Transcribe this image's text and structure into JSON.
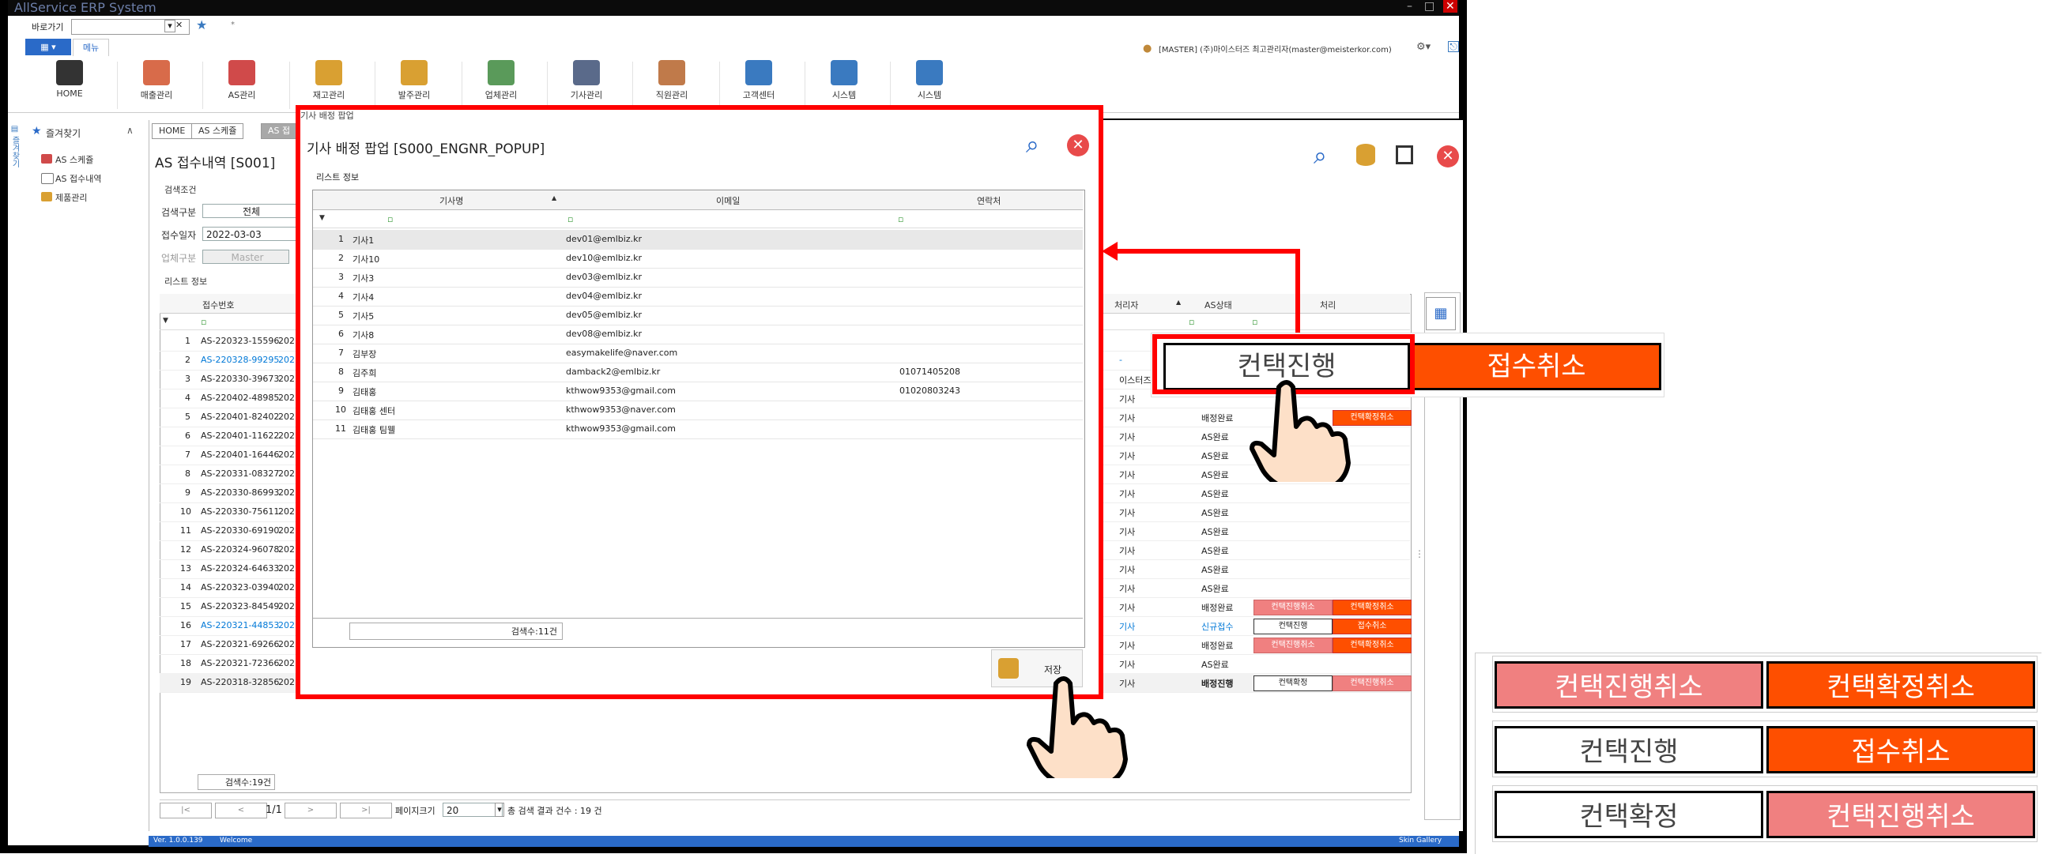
{
  "app": {
    "title": "AllService ERP System",
    "window_controls": [
      "–",
      "□",
      "✕"
    ],
    "quick_label": "바로가기",
    "user_info": "[MASTER] (주)마이스터즈 최고관리자(master@meisterkor.com)",
    "menu_tab": "메뉴",
    "version": "Ver. 1.0.0.139",
    "status_welcome": "Welcome",
    "skin_gallery": "Skin Gallery"
  },
  "ribbon": [
    {
      "label": "HOME",
      "icon": "home-icon",
      "color": "#333333"
    },
    {
      "label": "매출관리",
      "icon": "sales-icon",
      "color": "#d86b4a"
    },
    {
      "label": "AS관리",
      "icon": "as-icon",
      "color": "#d04a4a"
    },
    {
      "label": "재고관리",
      "icon": "inventory-icon",
      "color": "#d9a032"
    },
    {
      "label": "발주관리",
      "icon": "order-icon",
      "color": "#d9a032"
    },
    {
      "label": "업체관리",
      "icon": "company-icon",
      "color": "#5a9a5a"
    },
    {
      "label": "기사관리",
      "icon": "engineer-card-icon",
      "color": "#5a6a8a"
    },
    {
      "label": "직원관리",
      "icon": "staff-icon",
      "color": "#c07a4a"
    },
    {
      "label": "고객센터",
      "icon": "customer-icon",
      "color": "#3a7ac0"
    },
    {
      "label": "시스템",
      "icon": "system-doc-icon",
      "color": "#3a7ac0"
    },
    {
      "label": "시스템",
      "icon": "gears-icon",
      "color": "#3a7ac0"
    }
  ],
  "sidebar": {
    "title": "즐겨찾기",
    "items": [
      {
        "label": "AS 스케쥴"
      },
      {
        "label": "AS 접수내역"
      },
      {
        "label": "제품관리"
      }
    ]
  },
  "tabs": [
    "HOME",
    "AS 스케쥴",
    "AS 접"
  ],
  "page": {
    "title": "AS 접수내역 [S001]",
    "search_group": "검색조건",
    "search_type_label": "검색구분",
    "search_type_value": "전체",
    "receipt_date_label": "접수일자",
    "receipt_date_value": "2022-03-03",
    "company_type_label": "업체구분",
    "company_type_value": "Master",
    "list_group": "리스트 정보",
    "col_receipt_no": "접수번호",
    "col_handler": "처리자",
    "col_as_status": "AS상태",
    "col_process": "처리",
    "count_text": "검색수:19건",
    "pager": {
      "first": "|<",
      "prev": "<",
      "page": "1/1",
      "next": ">",
      "last": ">|",
      "size_label": "페이지크기",
      "size_value": "20",
      "total": "총 검색 결과 건수 : 19 건"
    }
  },
  "bg_rows": [
    {
      "no": "1",
      "receipt": "AS-220323-15596",
      "date": "202",
      "handler": "",
      "status": "",
      "btn1": "",
      "btn2": ""
    },
    {
      "no": "2",
      "receipt": "AS-220328-99295",
      "date": "202",
      "handler": "-",
      "status": "",
      "btn1": "",
      "btn2": "",
      "blue": true
    },
    {
      "no": "3",
      "receipt": "AS-220330-39673",
      "date": "202",
      "handler": "이스터즈 최고",
      "status": "",
      "btn1": "",
      "btn2": ""
    },
    {
      "no": "4",
      "receipt": "AS-220402-48985",
      "date": "202",
      "handler": "기사",
      "status": "",
      "btn1": "",
      "btn2": ""
    },
    {
      "no": "5",
      "receipt": "AS-220401-82402",
      "date": "202",
      "handler": "기사",
      "status": "배정완료",
      "btn1": "",
      "btn2": "컨택확정취소"
    },
    {
      "no": "6",
      "receipt": "AS-220401-11622",
      "date": "202",
      "handler": "기사",
      "status": "AS완료",
      "btn1": "",
      "btn2": ""
    },
    {
      "no": "7",
      "receipt": "AS-220401-16446",
      "date": "202",
      "handler": "기사",
      "status": "AS완료",
      "btn1": "",
      "btn2": ""
    },
    {
      "no": "8",
      "receipt": "AS-220331-08327",
      "date": "202",
      "handler": "기사",
      "status": "AS완료",
      "btn1": "",
      "btn2": ""
    },
    {
      "no": "9",
      "receipt": "AS-220330-86993",
      "date": "202",
      "handler": "기사",
      "status": "AS완료",
      "btn1": "",
      "btn2": ""
    },
    {
      "no": "10",
      "receipt": "AS-220330-75611",
      "date": "202",
      "handler": "기사",
      "status": "AS완료",
      "btn1": "",
      "btn2": ""
    },
    {
      "no": "11",
      "receipt": "AS-220330-69190",
      "date": "202",
      "handler": "기사",
      "status": "AS완료",
      "btn1": "",
      "btn2": ""
    },
    {
      "no": "12",
      "receipt": "AS-220324-96078",
      "date": "202",
      "handler": "기사",
      "status": "AS완료",
      "btn1": "",
      "btn2": ""
    },
    {
      "no": "13",
      "receipt": "AS-220324-64633",
      "date": "202",
      "handler": "기사",
      "status": "AS완료",
      "btn1": "",
      "btn2": ""
    },
    {
      "no": "14",
      "receipt": "AS-220323-03940",
      "date": "202",
      "handler": "기사",
      "status": "AS완료",
      "btn1": "",
      "btn2": ""
    },
    {
      "no": "15",
      "receipt": "AS-220323-84549",
      "date": "202",
      "handler": "기사",
      "status": "배정완료",
      "btn1": "컨택진행취소",
      "btn2": "컨택확정취소"
    },
    {
      "no": "16",
      "receipt": "AS-220321-44853",
      "date": "202",
      "handler": "기사",
      "status": "신규접수",
      "btn1": "컨택진행",
      "btn2": "접수취소",
      "blue": true
    },
    {
      "no": "17",
      "receipt": "AS-220321-69266",
      "date": "202",
      "handler": "기사",
      "status": "배정완료",
      "btn1": "컨택진행취소",
      "btn2": "컨택확정취소"
    },
    {
      "no": "18",
      "receipt": "AS-220321-72366",
      "date": "202",
      "handler": "기사",
      "status": "AS완료",
      "btn1": "",
      "btn2": ""
    },
    {
      "no": "19",
      "receipt": "AS-220318-32856",
      "date": "202",
      "handler": "기사",
      "status": "배정진행",
      "btn1": "컨택확정",
      "btn2": "컨택진행취소"
    }
  ],
  "popup": {
    "window_title": "기사 배정 팝업",
    "heading": "기사 배정 팝업 [S000_ENGNR_POPUP]",
    "list_group": "리스트 정보",
    "col_name": "기사명",
    "col_email": "이메일",
    "col_phone": "연락처",
    "count_text": "검색수:11건",
    "save_label": "저장",
    "rows": [
      {
        "no": "1",
        "name": "기사1",
        "email": "dev01@emlbiz.kr",
        "phone": ""
      },
      {
        "no": "2",
        "name": "기사10",
        "email": "dev10@emlbiz.kr",
        "phone": ""
      },
      {
        "no": "3",
        "name": "기사3",
        "email": "dev03@emlbiz.kr",
        "phone": ""
      },
      {
        "no": "4",
        "name": "기사4",
        "email": "dev04@emlbiz.kr",
        "phone": ""
      },
      {
        "no": "5",
        "name": "기사5",
        "email": "dev05@emlbiz.kr",
        "phone": ""
      },
      {
        "no": "6",
        "name": "기사8",
        "email": "dev08@emlbiz.kr",
        "phone": ""
      },
      {
        "no": "7",
        "name": "김부장",
        "email": "easymakelife@naver.com",
        "phone": ""
      },
      {
        "no": "8",
        "name": "김주희",
        "email": "damback2@emlbiz.kr",
        "phone": "01071405208"
      },
      {
        "no": "9",
        "name": "김태홍",
        "email": "kthwow9353@gmail.com",
        "phone": "01020803243"
      },
      {
        "no": "10",
        "name": "김태홍 센터",
        "email": "kthwow9353@naver.com",
        "phone": ""
      },
      {
        "no": "11",
        "name": "김태홍 팀웰",
        "email": "kthwow9353@gmail.com",
        "phone": ""
      }
    ]
  },
  "zoom_callout": {
    "btn1": "컨택진행",
    "btn2": "접수취소"
  },
  "legend": [
    {
      "btn1": "컨택진행취소",
      "btn2": "컨택확정취소",
      "color1": "#f08080",
      "color2": "#fe4f00"
    },
    {
      "btn1": "컨택진행",
      "btn2": "접수취소",
      "color1": "#ffffff",
      "color2": "#fe4f00"
    },
    {
      "btn1": "컨택확정",
      "btn2": "컨택진행취소",
      "color1": "#ffffff",
      "color2": "#f08080"
    }
  ],
  "colors": {
    "accent_red": "#ff0000",
    "orange": "#fe4f00",
    "pink": "#f08080",
    "status_blue": "#0078d7"
  }
}
